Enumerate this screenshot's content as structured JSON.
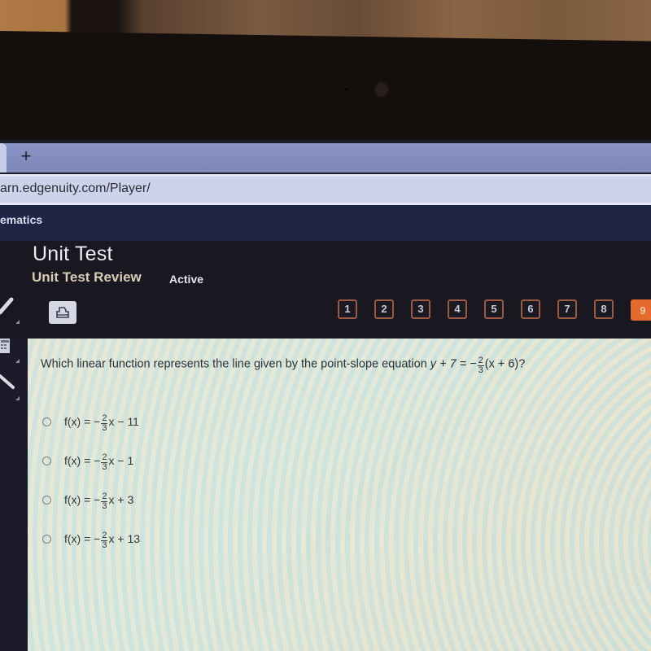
{
  "browser": {
    "new_tab_symbol": "+",
    "url": "arn.edgenuity.com/Player/"
  },
  "course": {
    "name": "ematics"
  },
  "header": {
    "title": "Unit Test",
    "subtitle": "Unit Test Review",
    "status": "Active"
  },
  "toolbar": {
    "print_icon": "printer-icon",
    "tools": [
      "pencil-icon",
      "calculator-icon",
      "highlighter-icon"
    ]
  },
  "question_nav": {
    "items": [
      "1",
      "2",
      "3",
      "4",
      "5",
      "6",
      "7",
      "8",
      "9"
    ],
    "current": "9",
    "accent_color": "#e56a2e"
  },
  "question": {
    "prefix": "Which linear function represents the line given by the point-slope equation ",
    "equation_lhs": "y + 7 = −",
    "frac_num": "2",
    "frac_den": "3",
    "equation_rhs": "(x + 6)?"
  },
  "options": [
    {
      "lhs": "f(x) = −",
      "num": "2",
      "den": "3",
      "rhs": "x − 11"
    },
    {
      "lhs": "f(x) = −",
      "num": "2",
      "den": "3",
      "rhs": "x − 1"
    },
    {
      "lhs": "f(x) = −",
      "num": "2",
      "den": "3",
      "rhs": "x + 3"
    },
    {
      "lhs": "f(x) = −",
      "num": "2",
      "den": "3",
      "rhs": "x + 13"
    }
  ]
}
